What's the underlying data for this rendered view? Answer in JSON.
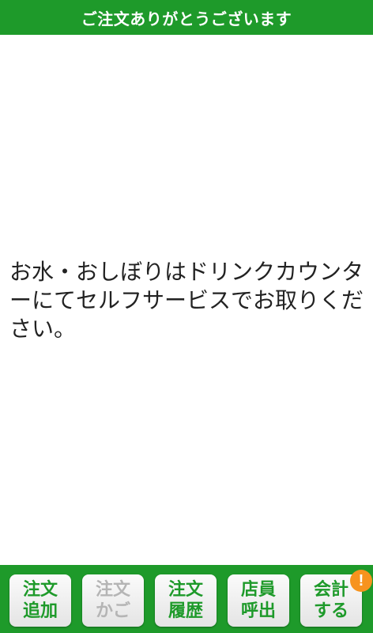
{
  "header": {
    "title": "ご注文ありがとうございます"
  },
  "main": {
    "message": "お水・おしぼりはドリンクカウンターにてセルフサービスでお取りください。"
  },
  "footer": {
    "buttons": [
      {
        "line1": "注文",
        "line2": "追加",
        "enabled": true
      },
      {
        "line1": "注文",
        "line2": "かご",
        "enabled": false
      },
      {
        "line1": "注文",
        "line2": "履歴",
        "enabled": true
      },
      {
        "line1": "店員",
        "line2": "呼出",
        "enabled": true
      },
      {
        "line1": "会計",
        "line2": "する",
        "enabled": true
      }
    ],
    "alert_badge": "!"
  },
  "colors": {
    "brand_green": "#1e9a2a",
    "disabled_text": "#b5b5b5",
    "badge_orange": "#f7931e"
  }
}
